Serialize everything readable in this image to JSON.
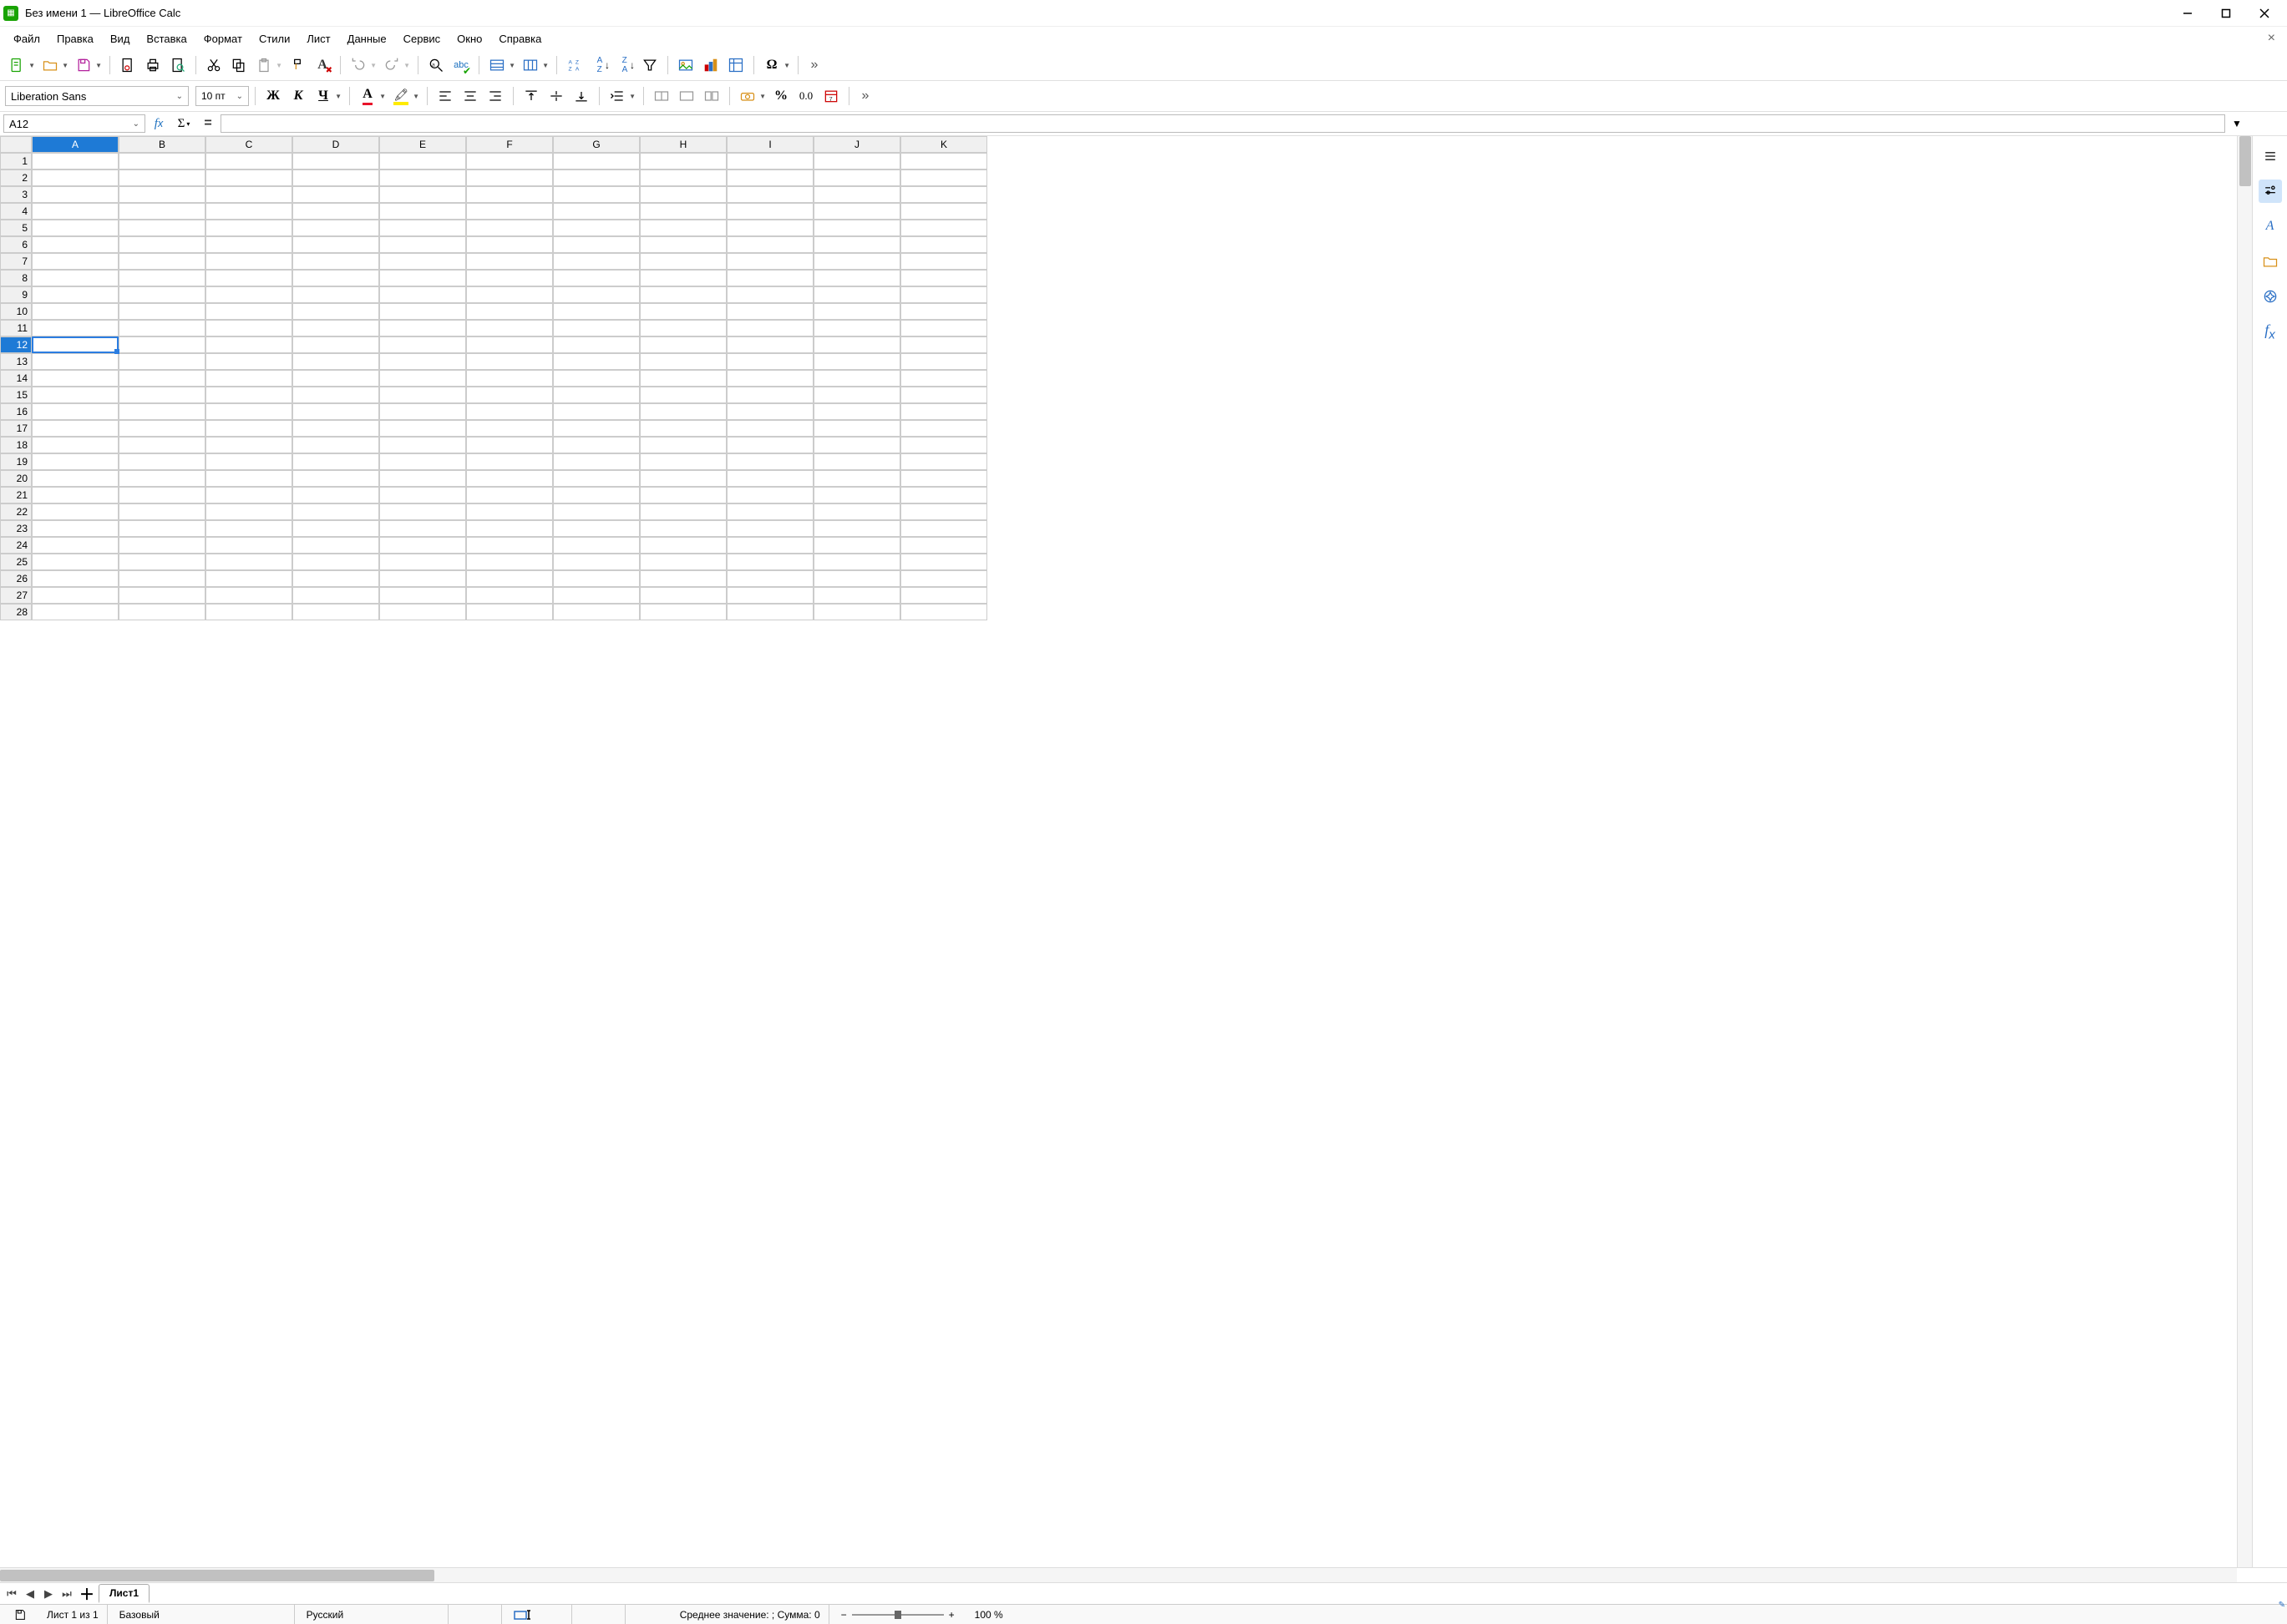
{
  "titlebar": {
    "title": "Без имени 1 — LibreOffice Calc"
  },
  "menus": [
    "Файл",
    "Правка",
    "Вид",
    "Вставка",
    "Формат",
    "Стили",
    "Лист",
    "Данные",
    "Сервис",
    "Окно",
    "Справка"
  ],
  "font": {
    "name": "Liberation Sans",
    "size": "10 пт"
  },
  "namebox": "A12",
  "formula": "",
  "columns": [
    "A",
    "B",
    "C",
    "D",
    "E",
    "F",
    "G",
    "H",
    "I",
    "J",
    "K"
  ],
  "rows": 28,
  "active": {
    "col": "A",
    "row": 12
  },
  "sheettab": "Лист1",
  "status": {
    "sheets": "Лист 1 из 1",
    "style": "Базовый",
    "lang": "Русский",
    "summary": "Среднее значение: ; Сумма: 0",
    "zoom": "100 %"
  }
}
